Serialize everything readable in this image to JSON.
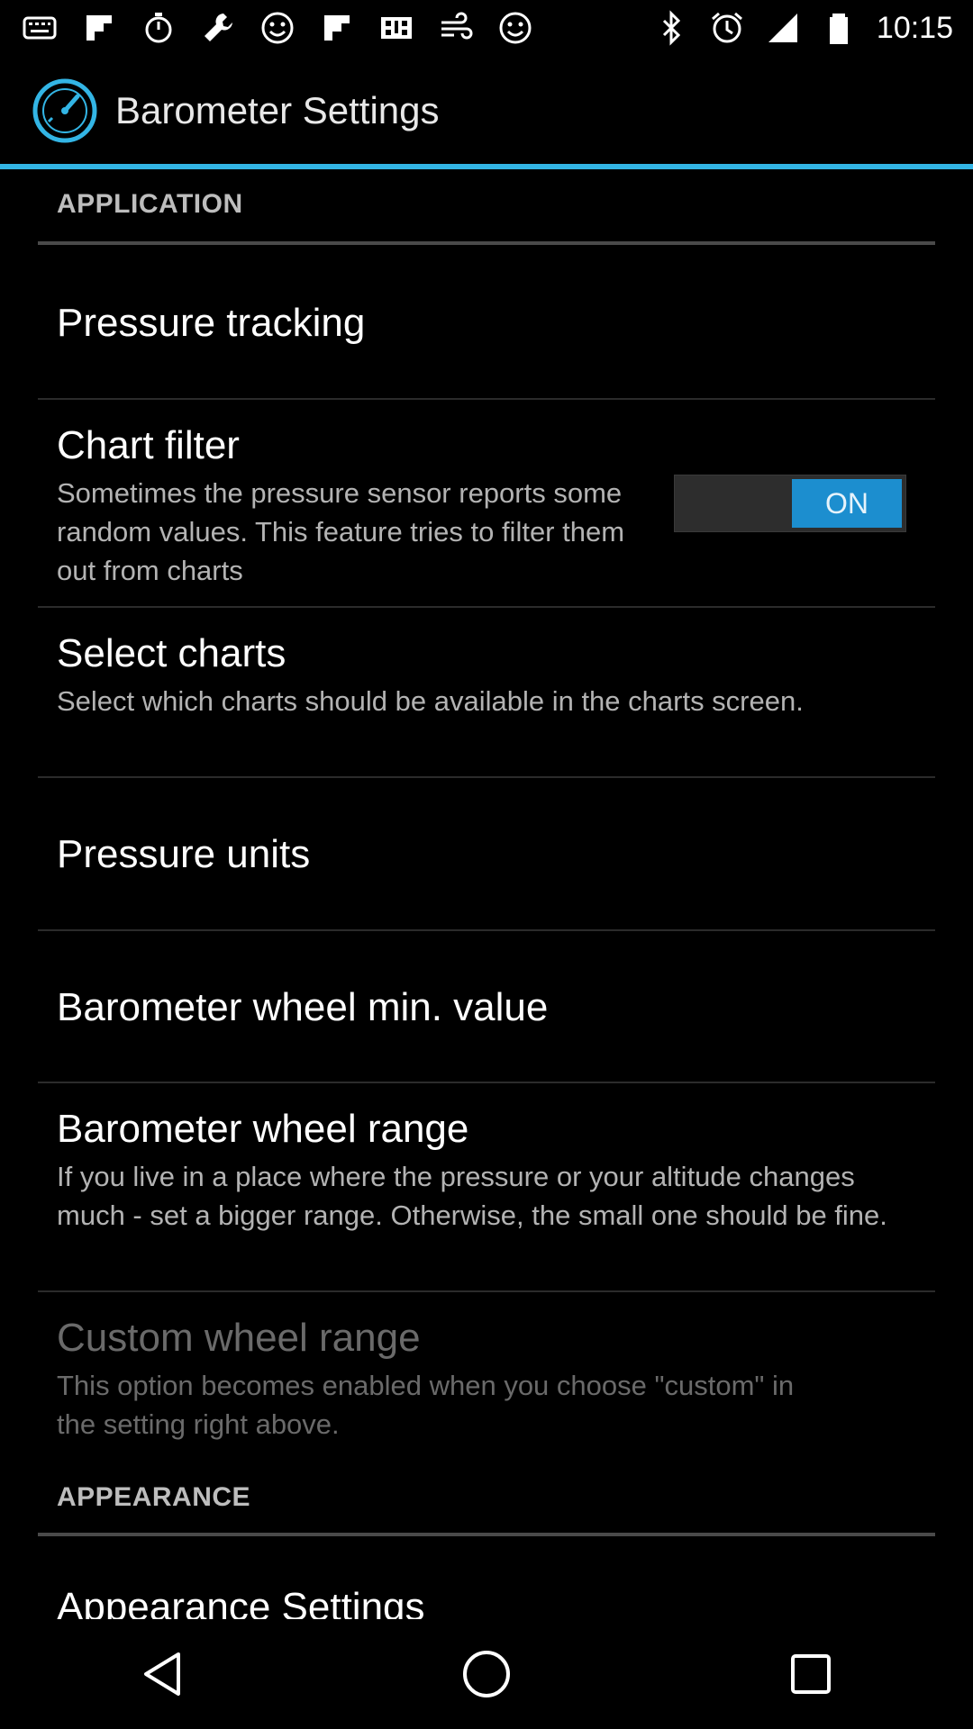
{
  "status_bar": {
    "time": "10:15",
    "left_icons": [
      "notification-icon",
      "flipboard-icon",
      "timer-icon",
      "wrench-icon",
      "smiley-icon",
      "flipboard-icon",
      "qr-icon",
      "wind-icon",
      "smiley-icon"
    ],
    "right_icons": [
      "bluetooth-icon",
      "alarm-icon",
      "signal-icon",
      "battery-icon"
    ]
  },
  "action_bar": {
    "title": "Barometer Settings",
    "accent_color": "#33b5e5"
  },
  "sections": {
    "application": {
      "header": "APPLICATION"
    },
    "appearance": {
      "header": "APPEARANCE"
    }
  },
  "prefs": {
    "pressure_tracking": {
      "title": "Pressure tracking"
    },
    "chart_filter": {
      "title": "Chart filter",
      "summary": "Sometimes the pressure sensor reports some random values. This feature tries to filter them out from charts",
      "toggle_label": "ON",
      "toggle_state": true
    },
    "select_charts": {
      "title": "Select charts",
      "summary": "Select which charts should be available in the charts screen."
    },
    "pressure_units": {
      "title": "Pressure units"
    },
    "wheel_min": {
      "title": "Barometer wheel min. value"
    },
    "wheel_range": {
      "title": "Barometer wheel range",
      "summary": "If you live in a place where the pressure or your altitude changes much - set a bigger range. Otherwise, the small one should be fine."
    },
    "custom_wheel_range": {
      "title": "Custom wheel range",
      "summary": "This option becomes enabled when you choose \"custom\" in the setting right above.",
      "enabled": false
    },
    "appearance_settings": {
      "title": "Appearance Settings"
    }
  },
  "nav_bar": {
    "back": "back-icon",
    "home": "home-icon",
    "recents": "recents-icon"
  }
}
